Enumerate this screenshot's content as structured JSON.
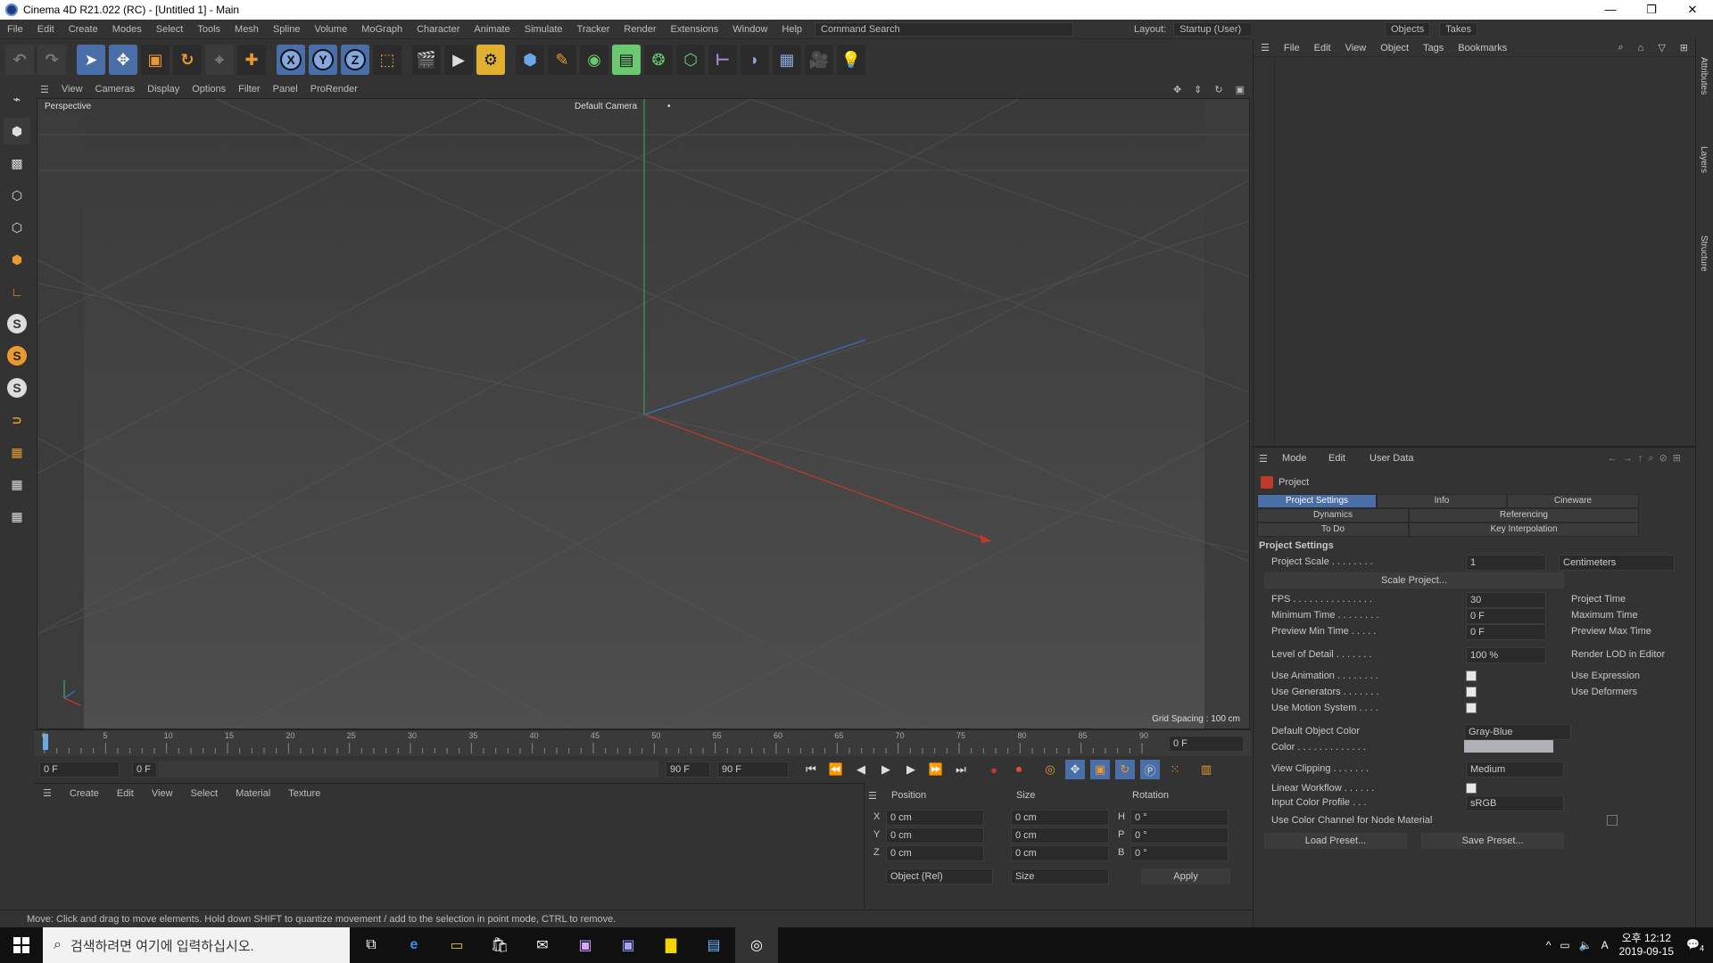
{
  "window": {
    "title": "Cinema 4D R21.022 (RC) - [Untitled 1] - Main",
    "minimize": "—",
    "restore": "❐",
    "close": "✕"
  },
  "menu": {
    "items": [
      "File",
      "Edit",
      "Create",
      "Modes",
      "Select",
      "Tools",
      "Mesh",
      "Spline",
      "Volume",
      "MoGraph",
      "Character",
      "Animate",
      "Simulate",
      "Tracker",
      "Render",
      "Extensions",
      "Window",
      "Help"
    ],
    "layout_label": "Layout:",
    "layout_value": "Startup (User)",
    "command_search": "Command Search"
  },
  "toolbar": {
    "icons": [
      "undo-icon",
      "redo-icon",
      "select-icon",
      "move-icon",
      "scale-icon",
      "rotate-icon",
      "recent-icon",
      "create-icon",
      "x-axis-icon",
      "y-axis-icon",
      "z-axis-icon",
      "coord-icon",
      "render-view-icon",
      "render-icon",
      "render-settings-icon",
      "cube-icon",
      "pen-icon",
      "subdivision-icon",
      "extrude-icon",
      "cloner-icon",
      "mograph-icon",
      "deformer-icon",
      "camera-icon",
      "floor-icon",
      "scene-icon",
      "light-icon"
    ],
    "axis_x": "X",
    "axis_y": "Y",
    "axis_z": "Z"
  },
  "viewport": {
    "menu": [
      "View",
      "Cameras",
      "Display",
      "Options",
      "Filter",
      "Panel",
      "ProRender"
    ],
    "name": "Perspective",
    "camera_label": "Default Camera",
    "camera_mark": "•",
    "grid_info": "Grid Spacing : 100 cm"
  },
  "timeline": {
    "ticks": [
      "0",
      "5",
      "10",
      "15",
      "20",
      "25",
      "30",
      "35",
      "40",
      "45",
      "50",
      "55",
      "60",
      "65",
      "70",
      "75",
      "80",
      "85",
      "90"
    ],
    "end_frame": "0 F",
    "current": "0 F",
    "start": "0 F",
    "min": "90 F",
    "max": "90 F"
  },
  "material": {
    "menu": [
      "Create",
      "Edit",
      "View",
      "Select",
      "Material",
      "Texture"
    ]
  },
  "coordinates": {
    "header": [
      "Position",
      "Size",
      "Rotation"
    ],
    "rows": [
      {
        "axis": "X",
        "pos": "0 cm",
        "size": "0 cm",
        "rot_axis": "H",
        "rot": "0 °"
      },
      {
        "axis": "Y",
        "pos": "0 cm",
        "size": "0 cm",
        "rot_axis": "P",
        "rot": "0 °"
      },
      {
        "axis": "Z",
        "pos": "0 cm",
        "size": "0 cm",
        "rot_axis": "B",
        "rot": "0 °"
      }
    ],
    "mode1": "Object (Rel)",
    "mode2": "Size",
    "apply": "Apply"
  },
  "status": "Move: Click and drag to move elements. Hold down SHIFT to quantize movement / add to the selection in point mode, CTRL to remove.",
  "objects": {
    "tabs": [
      "File",
      "Edit",
      "View",
      "Object",
      "Tags",
      "Bookmarks"
    ],
    "rightbar": [
      "Objects",
      "Takes"
    ],
    "side_tabs": [
      "Attributes",
      "Layers",
      "Structure"
    ]
  },
  "attributes": {
    "menu": [
      "Mode",
      "Edit",
      "User Data"
    ],
    "title": "Project",
    "tabs": [
      "Project Settings",
      "Info",
      "Cineware",
      "Dynamics",
      "Referencing",
      "To Do",
      "Key Interpolation"
    ],
    "section": "Project Settings",
    "rows": [
      {
        "label": "Project Scale . . . . . . . .",
        "value": "1",
        "unit": "Centimeters"
      },
      {
        "label": "Scale Project...",
        "value": ""
      },
      {
        "label": "FPS . . . . . . . . . . . . . . .",
        "value": "30",
        "right": "Project Time"
      },
      {
        "label": "Minimum Time . . . . . . . .",
        "value": "0 F",
        "right": "Maximum Time"
      },
      {
        "label": "Preview Min Time . . . . .",
        "value": "0 F",
        "right": "Preview Max Time"
      },
      {
        "label": "Level of Detail . . . . . . .",
        "value": "100 %",
        "right": "Render LOD in Editor"
      },
      {
        "label": "Use Animation . . . . . . . .",
        "right": "Use Expression"
      },
      {
        "label": "Use Generators . . . . . . .",
        "right": "Use Deformers"
      },
      {
        "label": "Use Motion System . . . ."
      },
      {
        "label": "Default Object Color",
        "value": "Gray-Blue"
      },
      {
        "label": "Color . . . . . . . . . . . . ."
      },
      {
        "label": "View Clipping . . . . . . .",
        "value": "Medium"
      },
      {
        "label": "Linear Workflow . . . . . ."
      },
      {
        "label": "Input Color Profile . . .",
        "value": "sRGB"
      },
      {
        "label": "Use Color Channel for Node Material"
      }
    ],
    "buttons": [
      "Load Preset...",
      "Save Preset..."
    ]
  },
  "taskbar": {
    "search_placeholder": "검색하려면 여기에 입력하십시오.",
    "apps": [
      "task-view-icon",
      "edge-icon",
      "explorer-icon",
      "store-icon",
      "mail-icon",
      "premiere-icon",
      "aftereffects-icon",
      "kakaotalk-icon",
      "app-icon",
      "cinema4d-icon"
    ],
    "clock_time": "오후 12:12",
    "clock_date": "2019-09-15",
    "ime": "A",
    "notif_count": "4"
  },
  "colors": {
    "accent": "#4a6ea8",
    "axis_x": "#c0392b",
    "axis_y": "#3a9a5a",
    "axis_z": "#3a6ec0",
    "viewport_bg": "#484848"
  }
}
